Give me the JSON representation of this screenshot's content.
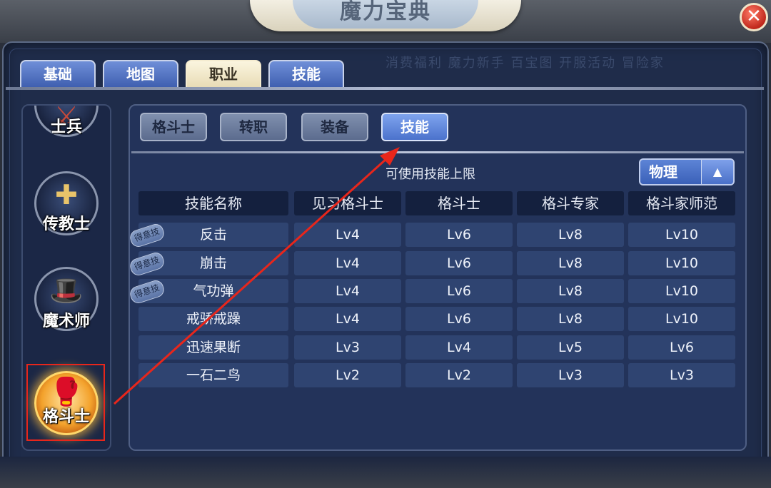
{
  "window": {
    "title": "魔力宝典",
    "close_glyph": "✕"
  },
  "ghost_text": "消费福利  魔力新手  百宝图  开服活动  冒险家",
  "main_tabs": [
    {
      "label": "基础",
      "active": false
    },
    {
      "label": "地图",
      "active": false
    },
    {
      "label": "职业",
      "active": true
    },
    {
      "label": "技能",
      "active": false
    }
  ],
  "classes": [
    {
      "label": "士兵",
      "icon": "soldier-icon",
      "selected": false
    },
    {
      "label": "传教士",
      "icon": "priest-icon",
      "selected": false
    },
    {
      "label": "魔术师",
      "icon": "magician-icon",
      "selected": false
    },
    {
      "label": "格斗士",
      "icon": "boxing-glove-icon",
      "selected": true
    }
  ],
  "sub_tabs": [
    {
      "label": "格斗士",
      "active": false
    },
    {
      "label": "转职",
      "active": false
    },
    {
      "label": "装备",
      "active": false
    },
    {
      "label": "技能",
      "active": true
    }
  ],
  "skill_table": {
    "limit_label": "可使用技能上限",
    "filter": {
      "selected": "物理",
      "arrow": "chevron-up-icon"
    },
    "headers": [
      "技能名称",
      "见习格斗士",
      "格斗士",
      "格斗专家",
      "格斗家师范"
    ],
    "badge_label": "得意技",
    "rows": [
      {
        "name": "反击",
        "badge": true,
        "levels": [
          "Lv4",
          "Lv6",
          "Lv8",
          "Lv10"
        ]
      },
      {
        "name": "崩击",
        "badge": true,
        "levels": [
          "Lv4",
          "Lv6",
          "Lv8",
          "Lv10"
        ]
      },
      {
        "name": "气功弹",
        "badge": true,
        "levels": [
          "Lv4",
          "Lv6",
          "Lv8",
          "Lv10"
        ]
      },
      {
        "name": "戒骄戒躁",
        "badge": false,
        "levels": [
          "Lv4",
          "Lv6",
          "Lv8",
          "Lv10"
        ]
      },
      {
        "name": "迅速果断",
        "badge": false,
        "levels": [
          "Lv3",
          "Lv4",
          "Lv5",
          "Lv6"
        ]
      },
      {
        "name": "一石二鸟",
        "badge": false,
        "levels": [
          "Lv2",
          "Lv2",
          "Lv3",
          "Lv3"
        ]
      }
    ]
  },
  "colors": {
    "annotation_red": "#e8261b",
    "active_tab": "#f5ecd0",
    "panel_bg": "#23335a"
  }
}
